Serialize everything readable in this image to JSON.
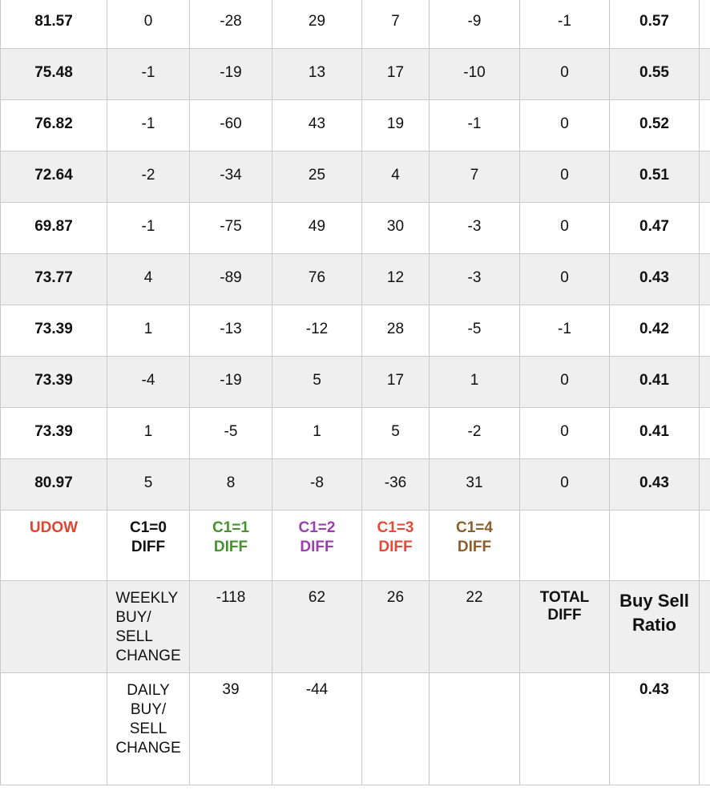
{
  "rows": [
    {
      "udow": "81.57",
      "c1_0": "0",
      "c1_1": "-28",
      "c1_2": "29",
      "c1_3": "7",
      "c1_4": "-9",
      "total_diff": "-1",
      "ratio": "0.57"
    },
    {
      "udow": "75.48",
      "c1_0": "-1",
      "c1_1": "-19",
      "c1_2": "13",
      "c1_3": "17",
      "c1_4": "-10",
      "total_diff": "0",
      "ratio": "0.55"
    },
    {
      "udow": "76.82",
      "c1_0": "-1",
      "c1_1": "-60",
      "c1_2": "43",
      "c1_3": "19",
      "c1_4": "-1",
      "total_diff": "0",
      "ratio": "0.52"
    },
    {
      "udow": "72.64",
      "c1_0": "-2",
      "c1_1": "-34",
      "c1_2": "25",
      "c1_3": "4",
      "c1_4": "7",
      "total_diff": "0",
      "ratio": "0.51"
    },
    {
      "udow": "69.87",
      "c1_0": "-1",
      "c1_1": "-75",
      "c1_2": "49",
      "c1_3": "30",
      "c1_4": "-3",
      "total_diff": "0",
      "ratio": "0.47"
    },
    {
      "udow": "73.77",
      "c1_0": "4",
      "c1_1": "-89",
      "c1_2": "76",
      "c1_3": "12",
      "c1_4": "-3",
      "total_diff": "0",
      "ratio": "0.43"
    },
    {
      "udow": "73.39",
      "c1_0": "1",
      "c1_1": "-13",
      "c1_2": "-12",
      "c1_3": "28",
      "c1_4": "-5",
      "total_diff": "-1",
      "ratio": "0.42"
    },
    {
      "udow": "73.39",
      "c1_0": "-4",
      "c1_1": "-19",
      "c1_2": "5",
      "c1_3": "17",
      "c1_4": "1",
      "total_diff": "0",
      "ratio": "0.41"
    },
    {
      "udow": "73.39",
      "c1_0": "1",
      "c1_1": "-5",
      "c1_2": "1",
      "c1_3": "5",
      "c1_4": "-2",
      "total_diff": "0",
      "ratio": "0.41"
    },
    {
      "udow": "80.97",
      "c1_0": "5",
      "c1_1": "8",
      "c1_2": "-8",
      "c1_3": "-36",
      "c1_4": "31",
      "total_diff": "0",
      "ratio": "0.43"
    }
  ],
  "header": {
    "udow": "UDOW",
    "c1_0": [
      "C1=0",
      "DIFF"
    ],
    "c1_1": [
      "C1=1",
      "DIFF"
    ],
    "c1_2": [
      "C1=2",
      "DIFF"
    ],
    "c1_3": [
      "C1=3",
      "DIFF"
    ],
    "c1_4": [
      "C1=4",
      "DIFF"
    ]
  },
  "weekly": {
    "label": [
      "WEEKLY",
      "BUY/",
      "SELL",
      "CHANGE"
    ],
    "c1_1": "-118",
    "c1_2": "62",
    "c1_3": "26",
    "c1_4": "22",
    "total_diff_label": [
      "TOTAL",
      "DIFF"
    ],
    "ratio_label": [
      "Buy Sell",
      "Ratio"
    ]
  },
  "daily": {
    "label": [
      "DAILY",
      "BUY/",
      "SELL",
      "CHANGE"
    ],
    "c1_1": "39",
    "c1_2": "-44",
    "ratio": "0.43"
  },
  "colors": {
    "udow_red": "#e0452f",
    "c1_1_green": "#45922f",
    "c1_2_purple": "#9b3fb0",
    "c1_3_red": "#e54a38",
    "c1_4_brown": "#8e5d2c",
    "weekly_blue": "#2a4fe0",
    "ratio_sky": "#4aa6ef",
    "alt_row_bg": "#efefef"
  }
}
